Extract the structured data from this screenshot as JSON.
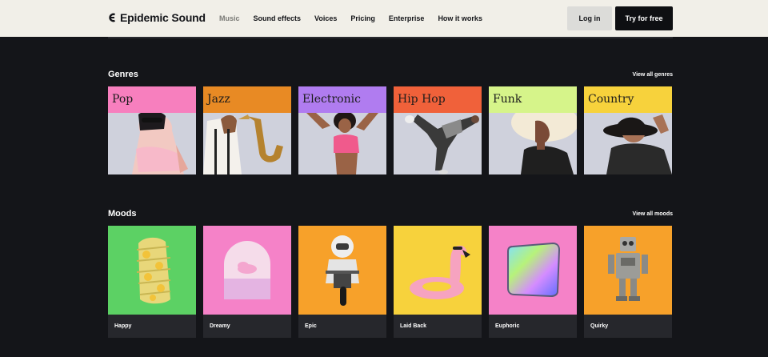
{
  "header": {
    "brand": "Epidemic Sound",
    "nav": [
      "Music",
      "Sound effects",
      "Voices",
      "Pricing",
      "Enterprise",
      "How it works"
    ],
    "active_nav": "Music",
    "login_label": "Log in",
    "try_label": "Try for free"
  },
  "genres": {
    "title": "Genres",
    "view_all": "View all genres",
    "items": [
      {
        "label": "Pop",
        "color": "#f77fbe"
      },
      {
        "label": "Jazz",
        "color": "#e88a24"
      },
      {
        "label": "Electronic",
        "color": "#b07cf0"
      },
      {
        "label": "Hip Hop",
        "color": "#f0613a"
      },
      {
        "label": "Funk",
        "color": "#d6f48a"
      },
      {
        "label": "Country",
        "color": "#f7d23c"
      }
    ]
  },
  "moods": {
    "title": "Moods",
    "view_all": "View all moods",
    "items": [
      {
        "label": "Happy",
        "color": "#5cd164",
        "icon": "smiley-tape-icon"
      },
      {
        "label": "Dreamy",
        "color": "#f582c8",
        "icon": "cloud-arch-icon"
      },
      {
        "label": "Epic",
        "color": "#f7a12a",
        "icon": "astronaut-motorbike-icon"
      },
      {
        "label": "Laid Back",
        "color": "#f7d23c",
        "icon": "flamingo-float-icon"
      },
      {
        "label": "Euphoric",
        "color": "#f582c8",
        "icon": "iridescent-tile-icon"
      },
      {
        "label": "Quirky",
        "color": "#f7a12a",
        "icon": "toy-robot-icon"
      }
    ]
  }
}
